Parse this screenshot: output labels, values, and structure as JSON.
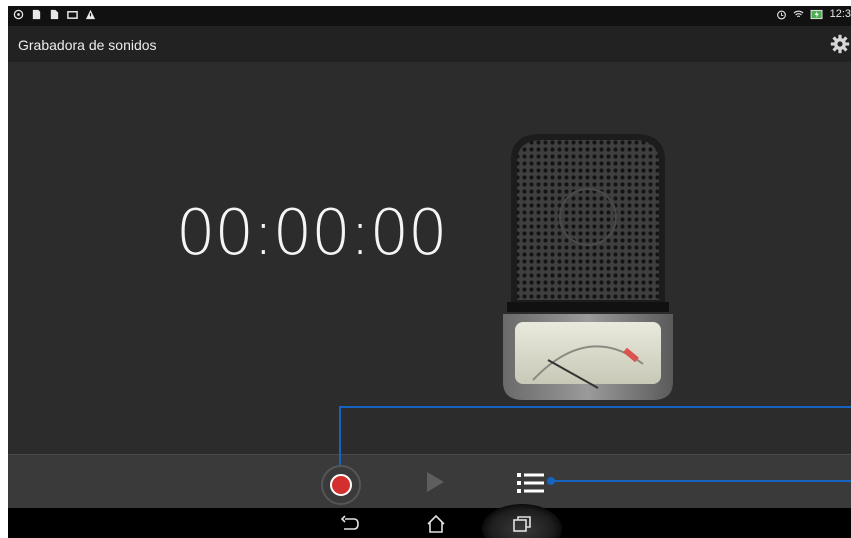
{
  "status_bar": {
    "left_icons": [
      "settings-cog-icon",
      "sd-card-icon",
      "document-icon",
      "screen-icon",
      "warning-icon"
    ],
    "right_icons": [
      "alarm-icon",
      "wifi-icon",
      "battery-charging-icon"
    ],
    "time": "12:3"
  },
  "app_bar": {
    "title": "Grabadora de sonidos",
    "settings_icon": "gear-icon"
  },
  "main": {
    "timer": "00:00:00",
    "illustration": "microphone-vu-meter-icon"
  },
  "controls": {
    "record_icon": "record-icon",
    "play_icon": "play-icon",
    "list_icon": "list-icon"
  },
  "nav": {
    "back_icon": "back-icon",
    "home_icon": "home-icon",
    "recent_icon": "recent-apps-icon"
  },
  "colors": {
    "record": "#d32f2f",
    "callout": "#1565c0",
    "background": "#2c2c2c"
  }
}
